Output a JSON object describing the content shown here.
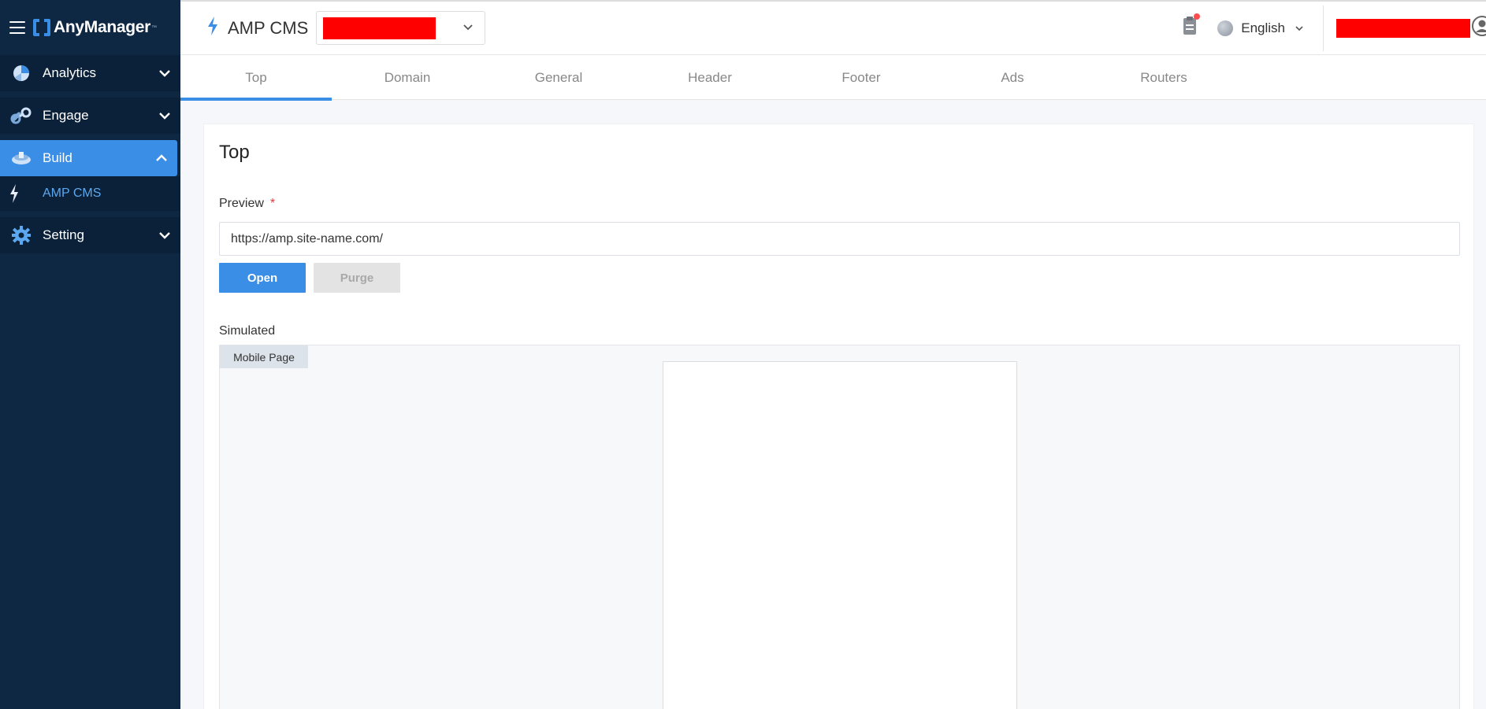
{
  "app": {
    "name": "AnyManager",
    "trademark": "™"
  },
  "sidebar": {
    "items": [
      {
        "label": "Analytics"
      },
      {
        "label": "Engage"
      },
      {
        "label": "Build",
        "sub": [
          {
            "label": "AMP CMS"
          }
        ]
      },
      {
        "label": "Setting"
      }
    ]
  },
  "header": {
    "page_name": "AMP CMS",
    "language": "English"
  },
  "tabs": [
    {
      "label": "Top"
    },
    {
      "label": "Domain"
    },
    {
      "label": "General"
    },
    {
      "label": "Header"
    },
    {
      "label": "Footer"
    },
    {
      "label": "Ads"
    },
    {
      "label": "Routers"
    }
  ],
  "main": {
    "title": "Top",
    "preview": {
      "label": "Preview",
      "required_mark": "*",
      "value": "https://amp.site-name.com/"
    },
    "buttons": {
      "open": "Open",
      "purge": "Purge"
    },
    "simulated": {
      "label": "Simulated",
      "tag": "Mobile Page"
    }
  },
  "colors": {
    "sidebar_bg": "#0e2844",
    "accent": "#3a8ee6",
    "redaction": "#ff0000"
  }
}
